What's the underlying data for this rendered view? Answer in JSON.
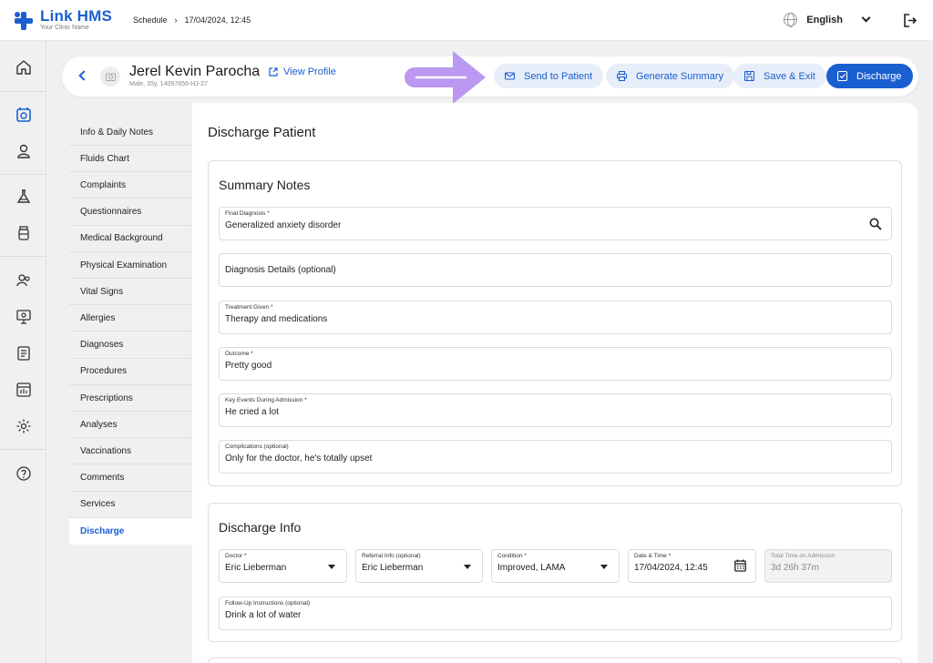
{
  "app": {
    "name": "Link HMS",
    "tagline": "Your Clinic Name"
  },
  "breadcrumb": {
    "section": "Schedule",
    "separator": "›",
    "current": "17/04/2024, 12:45"
  },
  "topbar": {
    "language": "English"
  },
  "patient": {
    "name": "Jerel Kevin Parocha",
    "meta": "Male, 35y, 14097856-HJ-27",
    "view_profile": "View Profile"
  },
  "actions": {
    "send": "Send to Patient",
    "summary": "Generate Summary",
    "save": "Save & Exit",
    "discharge": "Discharge"
  },
  "menu": [
    "Info & Daily Notes",
    "Fluids Chart",
    "Complaints",
    "Questionnaires",
    "Medical Background",
    "Physical Examination",
    "Vital Signs",
    "Allergies",
    "Diagnoses",
    "Procedures",
    "Prescriptions",
    "Analyses",
    "Vaccinations",
    "Comments",
    "Services",
    "Discharge"
  ],
  "page_title": "Discharge Patient",
  "summary": {
    "title": "Summary Notes",
    "final_diagnosis": {
      "label": "Final Diagnosis *",
      "value": "Generalized anxiety disorder"
    },
    "diagnosis_details": {
      "placeholder": "Diagnosis Details (optional)"
    },
    "treatment": {
      "label": "Treatment Given *",
      "value": "Therapy and medications"
    },
    "outcome": {
      "label": "Outcome *",
      "value": "Pretty good"
    },
    "key_events": {
      "label": "Key Events During Admission *",
      "value": "He cried a lot"
    },
    "complications": {
      "label": "Complications (optional)",
      "value": "Only for the doctor, he's totally upset"
    }
  },
  "discharge_info": {
    "title": "Discharge Info",
    "doctor": {
      "label": "Doctor *",
      "value": "Eric Lieberman"
    },
    "referral": {
      "label": "Referral Info (optional)",
      "value": "Eric Lieberman"
    },
    "condition": {
      "label": "Condition *",
      "value": "Improved, LAMA"
    },
    "datetime": {
      "label": "Date & Time *",
      "value": "17/04/2024, 12:45"
    },
    "total_time": {
      "label": "Total Time on Admission",
      "value": "3d 26h 37m"
    },
    "followup": {
      "label": "Follow-Up Instructions (optional)",
      "value": "Drink a lot of water"
    }
  },
  "colors": {
    "accent": "#1a5fd0",
    "hint_arrow": "#b792f0"
  }
}
